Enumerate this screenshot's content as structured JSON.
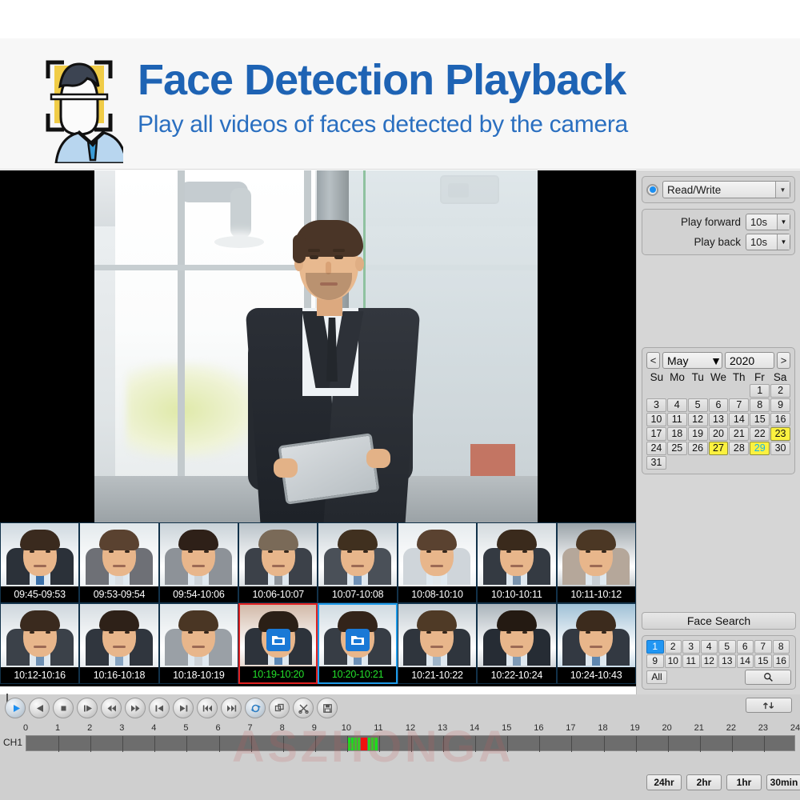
{
  "banner": {
    "title": "Face Detection Playback",
    "subtitle": "Play all videos of faces detected by the camera",
    "logo_icon": "face-detection-icon"
  },
  "watermark": "ASZHONGA",
  "side_panel": {
    "mode": {
      "radio_selected": true,
      "value": "Read/Write",
      "caret": "▼"
    },
    "speed": {
      "forward_label": "Play forward",
      "forward_value": "10s",
      "back_label": "Play back",
      "back_value": "10s",
      "caret": "▼"
    },
    "calendar": {
      "prev": "<",
      "next": ">",
      "month": "May",
      "year": "2020",
      "caret": "▼",
      "dow": [
        "Su",
        "Mo",
        "Tu",
        "We",
        "Th",
        "Fr",
        "Sa"
      ],
      "leading_blanks": 5,
      "days": [
        1,
        2,
        3,
        4,
        5,
        6,
        7,
        8,
        9,
        10,
        11,
        12,
        13,
        14,
        15,
        16,
        17,
        18,
        19,
        20,
        21,
        22,
        23,
        24,
        25,
        26,
        27,
        28,
        29,
        30,
        31
      ],
      "highlighted": [
        23,
        27,
        29
      ],
      "selected": 29
    },
    "face_search": {
      "title": "Face Search",
      "channels": [
        "1",
        "2",
        "3",
        "4",
        "5",
        "6",
        "7",
        "8",
        "9",
        "10",
        "11",
        "12",
        "13",
        "14",
        "15",
        "16"
      ],
      "selected_channel": "1",
      "all_label": "All",
      "search_icon": "magnifier-icon"
    }
  },
  "thumbnails": {
    "row1": [
      {
        "time": "09:45-09:53",
        "state": "normal",
        "hair": "#3a2a1e",
        "suit": "#2b3139",
        "tie": "#3a6fa8",
        "bg": "#cfd9e0"
      },
      {
        "time": "09:53-09:54",
        "state": "normal",
        "hair": "#5a4230",
        "suit": "#6e7076",
        "tie": "#d8dde2",
        "bg": "#e3e9ec"
      },
      {
        "time": "09:54-10:06",
        "state": "normal",
        "hair": "#2e2018",
        "suit": "#8d9298",
        "tie": "#cdd4d9",
        "bg": "#c9d2d8"
      },
      {
        "time": "10:06-10:07",
        "state": "normal",
        "hair": "#7a6a58",
        "suit": "#3c4149",
        "tie": "#8e949b",
        "bg": "#b9c2c8"
      },
      {
        "time": "10:07-10:08",
        "state": "normal",
        "hair": "#40301f",
        "suit": "#4a5058",
        "tie": "#6f90b5",
        "bg": "#c6cfd5"
      },
      {
        "time": "10:08-10:10",
        "state": "normal",
        "hair": "#5a4230",
        "suit": "#cfd5da",
        "tie": "#dfe5e9",
        "bg": "#e6ebee"
      },
      {
        "time": "10:10-10:11",
        "state": "normal",
        "hair": "#3a2a1c",
        "suit": "#343a42",
        "tie": "#7a93ad",
        "bg": "#d3dade"
      },
      {
        "time": "10:11-10:12",
        "state": "normal",
        "hair": "#4b3724",
        "suit": "#b5a79a",
        "tie": "#c8ced3",
        "bg": "#9aa3a9"
      }
    ],
    "row2": [
      {
        "time": "10:12-10:16",
        "state": "normal",
        "hair": "#3a2a1e",
        "suit": "#3b4149",
        "tie": "#6d8fb2",
        "bg": "#cdd6dc"
      },
      {
        "time": "10:16-10:18",
        "state": "normal",
        "hair": "#2e2118",
        "suit": "#30363e",
        "tie": "#86a3c0",
        "bg": "#d6dde2"
      },
      {
        "time": "10:18-10:19",
        "state": "normal",
        "hair": "#4a3624",
        "suit": "#9aa0a6",
        "tie": "#ccd2d7",
        "bg": "#dde4e8"
      },
      {
        "time": "10:19-10:20",
        "state": "locked-red",
        "hair": "#2b1f16",
        "suit": "#2d333b",
        "tie": "#5b87b5",
        "bg": "#d2b9a8",
        "badge": "lock-folder-icon"
      },
      {
        "time": "10:20-10:21",
        "state": "locked-blue",
        "hair": "#33241a",
        "suit": "#373d45",
        "tie": "#6b8fb6",
        "bg": "#cfdae1",
        "badge": "lock-folder-icon"
      },
      {
        "time": "10:21-10:22",
        "state": "normal",
        "hair": "#4f3a26",
        "suit": "#2f353d",
        "tie": "#9fb4c8",
        "bg": "#c3ccd2"
      },
      {
        "time": "10:22-10:24",
        "state": "normal",
        "hair": "#241a12",
        "suit": "#262c34",
        "tie": "#7e9ab5",
        "bg": "#a9b3ba"
      },
      {
        "time": "10:24-10:43",
        "state": "normal",
        "hair": "#3c2b1d",
        "suit": "#333942",
        "tie": "#5f87b0",
        "bg": "#9fc0d6"
      }
    ]
  },
  "playback_controls": [
    {
      "name": "play-button",
      "icon": "play",
      "active": true
    },
    {
      "name": "reverse-play-button",
      "icon": "play-reverse",
      "active": false
    },
    {
      "name": "stop-button",
      "icon": "stop",
      "active": false
    },
    {
      "name": "frame-step-button",
      "icon": "frame-step",
      "active": false
    },
    {
      "name": "rewind-button",
      "icon": "rewind",
      "active": false
    },
    {
      "name": "fast-forward-button",
      "icon": "fast-forward",
      "active": false
    },
    {
      "name": "previous-button",
      "icon": "skip-prev",
      "active": false
    },
    {
      "name": "next-button",
      "icon": "skip-next",
      "active": false
    },
    {
      "name": "first-record-button",
      "icon": "first",
      "active": false
    },
    {
      "name": "last-record-button",
      "icon": "last",
      "active": false
    },
    {
      "name": "loop-button",
      "icon": "loop",
      "active": true
    },
    {
      "name": "backup-button",
      "icon": "copy",
      "active": false
    },
    {
      "name": "clip-button",
      "icon": "scissors",
      "active": false
    },
    {
      "name": "save-button",
      "icon": "save",
      "active": false
    }
  ],
  "stop_checkbox": {
    "name": "stop-checkbox",
    "checked": false
  },
  "timeline": {
    "channel_label": "CH1",
    "ticks": [
      "0",
      "1",
      "2",
      "3",
      "4",
      "5",
      "6",
      "7",
      "8",
      "9",
      "10",
      "11",
      "12",
      "13",
      "14",
      "15",
      "16",
      "17",
      "18",
      "19",
      "20",
      "21",
      "22",
      "23",
      "24"
    ],
    "range": [
      0,
      24
    ],
    "recordings": [
      {
        "start": 10.02,
        "end": 10.1,
        "color": "#19e01c"
      },
      {
        "start": 10.13,
        "end": 10.2,
        "color": "#19e01c"
      },
      {
        "start": 10.23,
        "end": 10.3,
        "color": "#19e01c"
      },
      {
        "start": 10.33,
        "end": 10.4,
        "color": "#19e01c"
      },
      {
        "start": 10.43,
        "end": 10.62,
        "color": "#f01010"
      },
      {
        "start": 10.66,
        "end": 10.72,
        "color": "#19e01c"
      },
      {
        "start": 10.76,
        "end": 10.82,
        "color": "#19e01c"
      },
      {
        "start": 10.86,
        "end": 10.95,
        "color": "#19e01c"
      }
    ]
  },
  "swap_button": {
    "name": "swap-channel-button",
    "icon": "up-down-arrows-icon"
  },
  "zoom_levels": [
    {
      "label": "24hr",
      "selected": false
    },
    {
      "label": "2hr",
      "selected": false
    },
    {
      "label": "1hr",
      "selected": false
    },
    {
      "label": "30min",
      "selected": false
    }
  ]
}
